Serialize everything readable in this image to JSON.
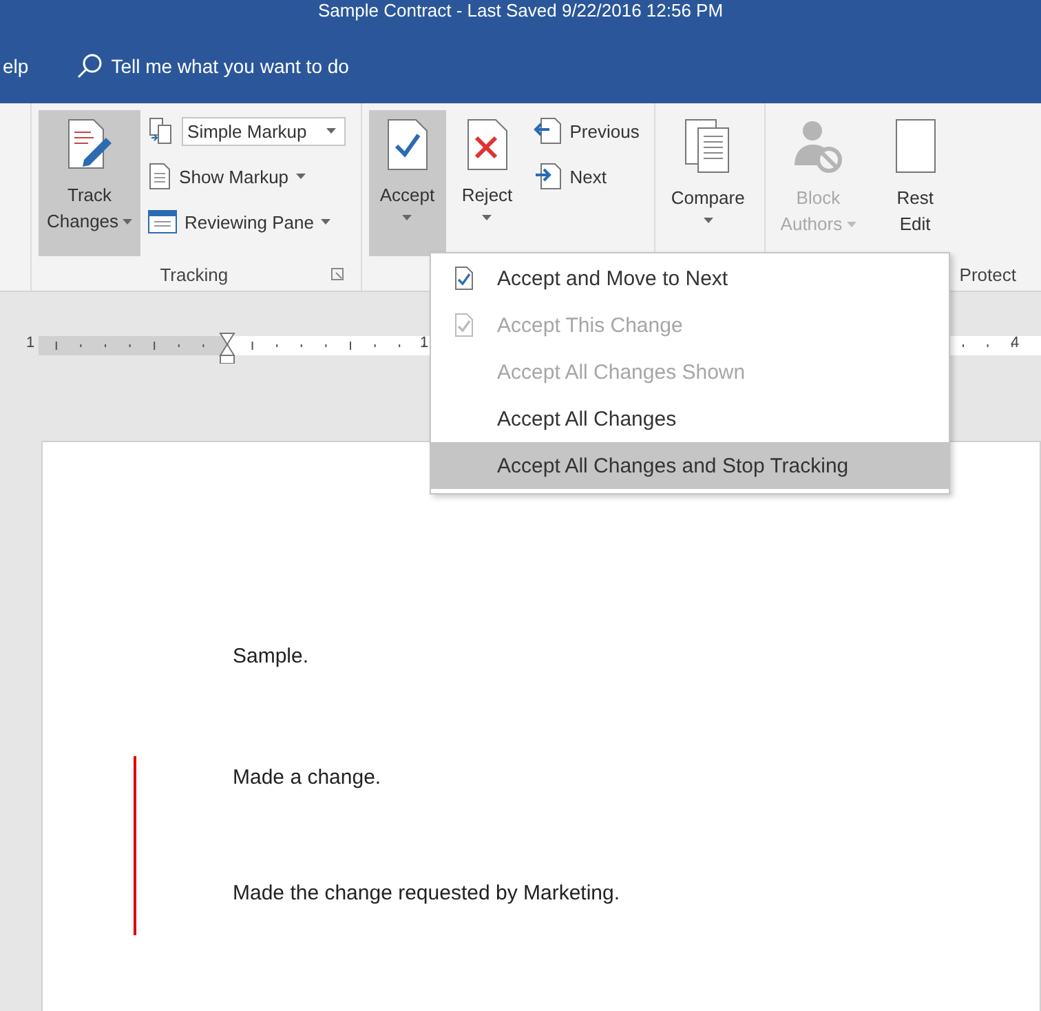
{
  "window": {
    "title": "Sample Contract  -  Last Saved 9/22/2016 12:56 PM"
  },
  "menu_bar": {
    "tab_fragment": "elp",
    "tell_me": "Tell me what you want to do"
  },
  "ribbon": {
    "groups": [
      {
        "label": "Tracking",
        "launcher": true,
        "controls": [
          {
            "kind": "big",
            "lines": [
              "Track",
              "Changes"
            ],
            "dropdown": true,
            "pressed": true,
            "disabled": false
          },
          {
            "kind": "stack",
            "items": [
              {
                "kind": "combo",
                "label": "Simple Markup",
                "dropdown": true
              },
              {
                "kind": "small",
                "label": "Show Markup",
                "dropdown": true
              },
              {
                "kind": "small",
                "label": "Reviewing Pane",
                "dropdown": true
              }
            ]
          }
        ]
      },
      {
        "controls": [
          {
            "kind": "split",
            "lines": [
              "Accept"
            ],
            "dropdown": true,
            "pressed": true,
            "disabled": false
          },
          {
            "kind": "split",
            "lines": [
              "Reject"
            ],
            "dropdown": true,
            "pressed": false,
            "disabled": false
          },
          {
            "kind": "stack",
            "items": [
              {
                "kind": "small",
                "label": "Previous"
              },
              {
                "kind": "small",
                "label": "Next"
              }
            ]
          }
        ]
      },
      {
        "controls": [
          {
            "kind": "split",
            "lines": [
              "Compare"
            ],
            "dropdown": true,
            "pressed": false,
            "disabled": false
          }
        ]
      },
      {
        "label": "Protect",
        "controls": [
          {
            "kind": "big",
            "lines": [
              "Block",
              "Authors"
            ],
            "dropdown": true,
            "pressed": false,
            "disabled": true
          },
          {
            "kind": "big",
            "lines": [
              "Rest",
              "Edit"
            ],
            "pressed": false,
            "disabled": false
          }
        ]
      }
    ]
  },
  "accept_menu": [
    {
      "label": "Accept and Move to Next",
      "checkmark": true,
      "disabled": false,
      "selected": false
    },
    {
      "label": "Accept This Change",
      "checkmark": true,
      "disabled": true,
      "selected": false
    },
    {
      "label": "Accept All Changes Shown",
      "checkmark": false,
      "disabled": true,
      "selected": false
    },
    {
      "label": "Accept All Changes",
      "checkmark": false,
      "disabled": false,
      "selected": false
    },
    {
      "label": "Accept All Changes and Stop Tracking",
      "checkmark": false,
      "disabled": false,
      "selected": true
    }
  ],
  "ruler": {
    "labels": [
      "1",
      "1",
      "4"
    ]
  },
  "document": {
    "paragraphs": [
      {
        "text": "Sample.",
        "changed": false
      },
      {
        "text": "Made a change.",
        "changed": true
      },
      {
        "text": "Made the change requested by Marketing.",
        "changed": true
      }
    ]
  }
}
